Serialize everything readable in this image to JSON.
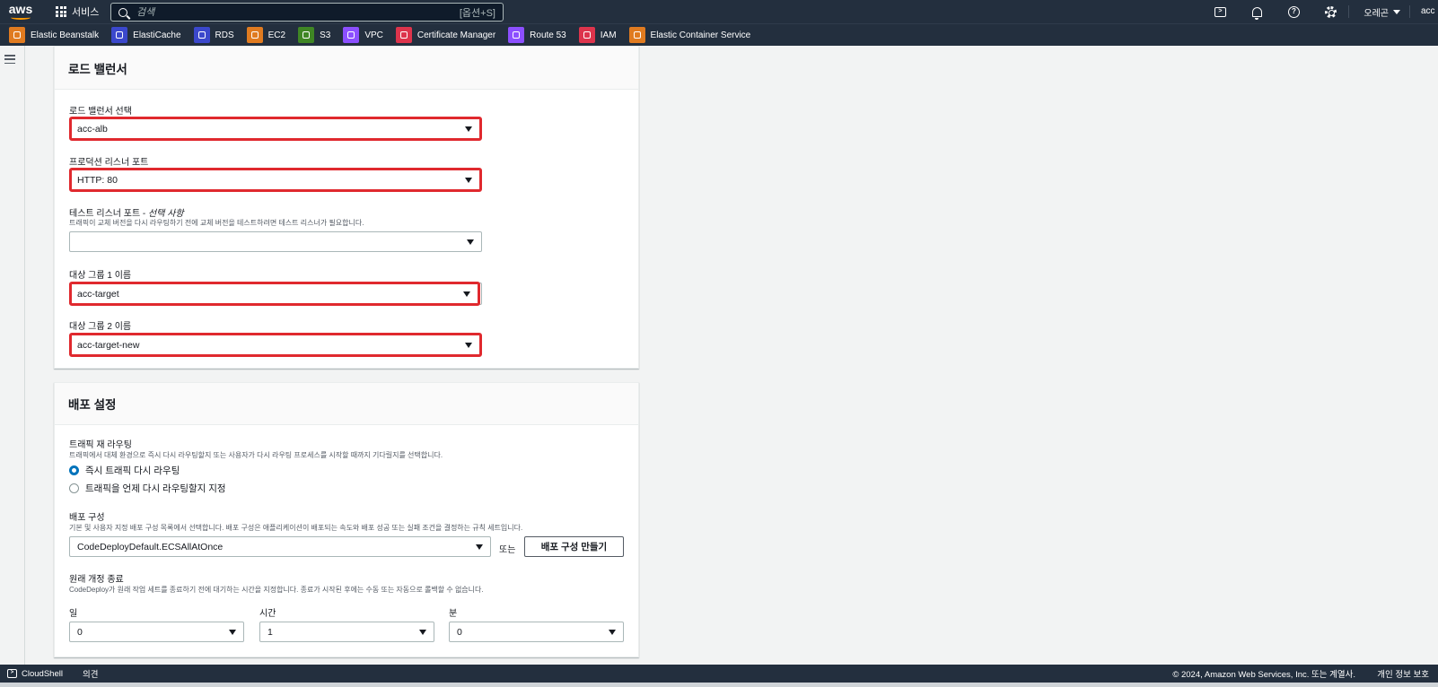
{
  "topnav": {
    "logo_text": "aws",
    "services_label": "서비스",
    "search_placeholder": "검색",
    "search_shortcut": "[옵션+S]",
    "region_label": "오레곤",
    "account_label": "acc"
  },
  "favorites": [
    {
      "label": "Elastic Beanstalk",
      "color": "#e07b20",
      "icon": "beanstalk-icon"
    },
    {
      "label": "ElastiCache",
      "color": "#3b48cc",
      "icon": "elasticache-icon"
    },
    {
      "label": "RDS",
      "color": "#3b48cc",
      "icon": "rds-icon"
    },
    {
      "label": "EC2",
      "color": "#e07b20",
      "icon": "ec2-icon"
    },
    {
      "label": "S3",
      "color": "#3f8624",
      "icon": "s3-icon"
    },
    {
      "label": "VPC",
      "color": "#8c4fff",
      "icon": "vpc-icon"
    },
    {
      "label": "Certificate Manager",
      "color": "#dd344c",
      "icon": "certificate-manager-icon"
    },
    {
      "label": "Route 53",
      "color": "#8c4fff",
      "icon": "route53-icon"
    },
    {
      "label": "IAM",
      "color": "#dd344c",
      "icon": "iam-icon"
    },
    {
      "label": "Elastic Container Service",
      "color": "#e07b20",
      "icon": "ecs-icon"
    }
  ],
  "load_balancer": {
    "title": "로드 밸런서",
    "lb_select_label": "로드 밸런서 선택",
    "lb_select_value": "acc-alb",
    "prod_listener_label": "프로덕션 리스너 포트",
    "prod_listener_value": "HTTP: 80",
    "test_listener_label": "테스트 리스너 포트 - ",
    "test_listener_optional": "선택 사항",
    "test_listener_desc": "트래픽이 교체 버전을 다시 라우팅하기 전에 교체 버전을 테스트하려면 테스트 리스너가 필요합니다.",
    "test_listener_value": "",
    "tg1_label": "대상 그룹 1 이름",
    "tg1_value": "acc-target",
    "tg2_label": "대상 그룹 2 이름",
    "tg2_value": "acc-target-new"
  },
  "deploy_settings": {
    "title": "배포 설정",
    "traffic_label": "트래픽 재 라우팅",
    "traffic_desc": "트래픽에서 대체 환경으로 즉시 다시 라우팅할지 또는 사용자가 다시 라우팅 프로세스를 시작할 때까지 기다릴지를 선택합니다.",
    "radio_immediate": "즉시 트래픽 다시 라우팅",
    "radio_specify": "트래픽을 언제 다시 라우팅할지 지정",
    "config_label": "배포 구성",
    "config_desc": "기본 및 사용자 지정 배포 구성 목록에서 선택합니다. 배포 구성은 애플리케이션이 배포되는 속도와 배포 성공 또는 실패 조건을 결정하는 규칙 세트입니다.",
    "config_value": "CodeDeployDefault.ECSAllAtOnce",
    "or_text": "또는",
    "create_config_button": "배포 구성 만들기",
    "terminate_label": "원래 개정 종료",
    "terminate_desc": "CodeDeploy가 원래 작업 세트를 종료하기 전에 대기하는 시간을 지정합니다. 종료가 시작된 후에는 수동 또는 자동으로 롤백할 수 없습니다.",
    "days_label": "일",
    "days_value": "0",
    "hours_label": "시간",
    "hours_value": "1",
    "minutes_label": "분",
    "minutes_value": "0"
  },
  "footer": {
    "cloudshell_label": "CloudShell",
    "feedback_label": "의견",
    "copyright": "© 2024, Amazon Web Services, Inc. 또는 계열사.",
    "privacy_label": "개인 정보 보호"
  },
  "highlight_color": "#e0292e"
}
